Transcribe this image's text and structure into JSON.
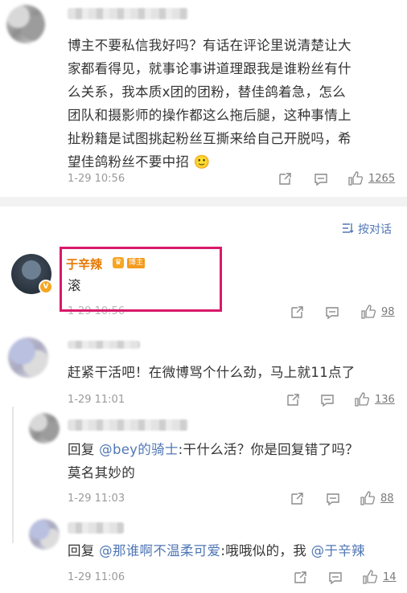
{
  "comments": [
    {
      "text": [
        "博主不要私信我好吗？有话在评论里说清楚让大",
        "家都看得见，就事论事讲道理跟我是谁粉丝有什",
        "么关系，我本质x团的团粉，替佳鸽着急，怎么",
        "团队和摄影师的操作都这么拖后腿，这种事情上",
        "扯粉籍是试图挑起粉丝互撕来给自己开脱吗，希",
        "望佳鸽粉丝不要中招"
      ],
      "emoji": "🙂",
      "time": "1-29 10:56",
      "likes": "1265"
    }
  ],
  "sort_label": "按对话",
  "author": {
    "name": "于辛辣",
    "badge": "博主",
    "text": "滚",
    "time": "1-29 10:56",
    "likes": "98"
  },
  "replies": [
    {
      "text": "赶紧干活吧！在微博骂个什么劲，马上就11点了",
      "time": "1-29 11:01",
      "likes": "136"
    },
    {
      "prefix": "回复",
      "mention": "@bey的骑士",
      "text_line1": ":干什么活？你是回复错了吗？",
      "text_line2": "莫名其妙的",
      "time": "1-29 11:03",
      "likes": "88"
    },
    {
      "prefix": "回复",
      "mention": "@那谁啊不温柔可爱",
      "text_mid": ":哦哦似的，我",
      "mention2": "@于辛辣",
      "time": "1-29 11:06",
      "likes": "14"
    }
  ],
  "icons": {
    "share": "share-icon",
    "comment": "comment-icon",
    "like": "thumbs-up-icon",
    "sort": "sort-icon"
  },
  "colors": {
    "accent": "#5077b5",
    "author": "#e67700",
    "highlight": "#d8196a"
  }
}
